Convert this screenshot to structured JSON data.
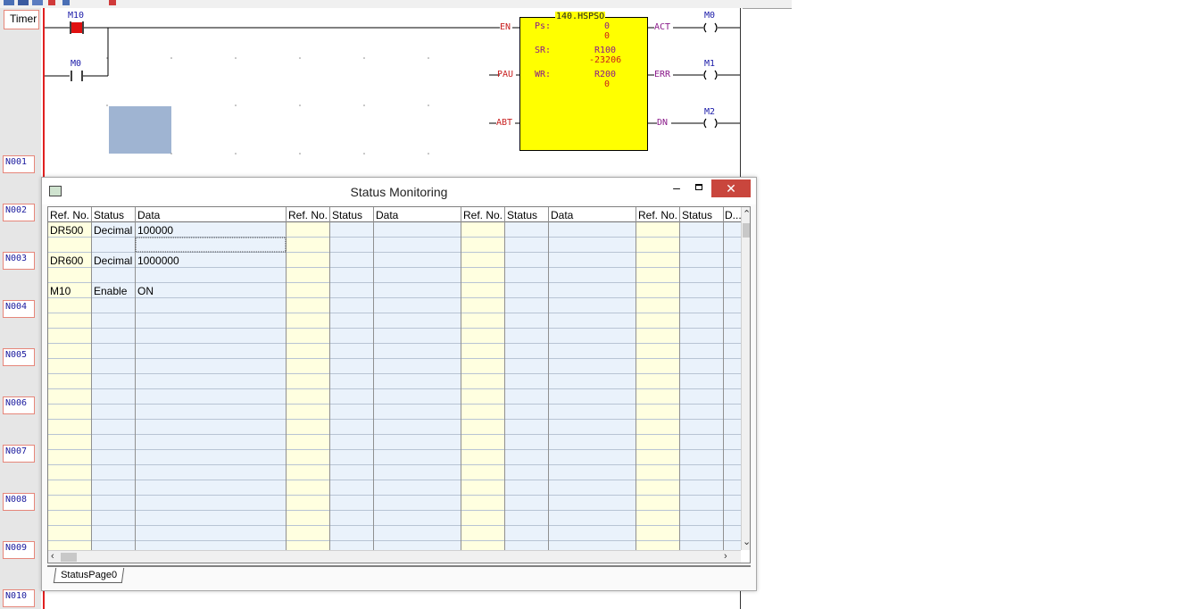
{
  "ladder": {
    "timer_label": "Timer",
    "rungs": [
      "N001",
      "N002",
      "N003",
      "N004",
      "N005",
      "N006",
      "N007",
      "N008",
      "N009",
      "N010"
    ],
    "contacts": [
      {
        "name": "M10",
        "state": "on"
      },
      {
        "name": "M0",
        "state": "off"
      }
    ],
    "function_block": {
      "title": "140.HSPSO",
      "inputs": [
        "EN",
        "PAU",
        "ABT"
      ],
      "outputs": [
        "ACT",
        "ERR",
        "DN"
      ],
      "params": [
        {
          "label": "Ps:",
          "ref": "0",
          "value": "0"
        },
        {
          "label": "SR:",
          "ref": "R100",
          "value": "-23206"
        },
        {
          "label": "WR:",
          "ref": "R200",
          "value": "0"
        }
      ],
      "fill_color": "#ffff00"
    },
    "coils": [
      "M0",
      "M1",
      "M2"
    ]
  },
  "status_window": {
    "title": "Status Monitoring",
    "buttons": {
      "minimize": "–",
      "maximize": "□",
      "close": "✕"
    },
    "columns": [
      "Ref. No.",
      "Status",
      "Data",
      "Ref. No.",
      "Status",
      "Data",
      "Ref. No.",
      "Status",
      "Data",
      "Ref. No.",
      "Status",
      "D..."
    ],
    "rows": [
      {
        "ref": "DR500",
        "status": "Decimal",
        "data": "100000"
      },
      {
        "ref": "",
        "status": "",
        "data": ""
      },
      {
        "ref": "DR600",
        "status": "Decimal",
        "data": "1000000"
      },
      {
        "ref": "",
        "status": "",
        "data": ""
      },
      {
        "ref": "M10",
        "status": "Enable",
        "data": "ON"
      }
    ],
    "sheet_tab": "StatusPage0",
    "colors": {
      "ref_col": "#ffffe0",
      "status_col": "#eaf2fb",
      "close_btn": "#c9463d"
    }
  }
}
